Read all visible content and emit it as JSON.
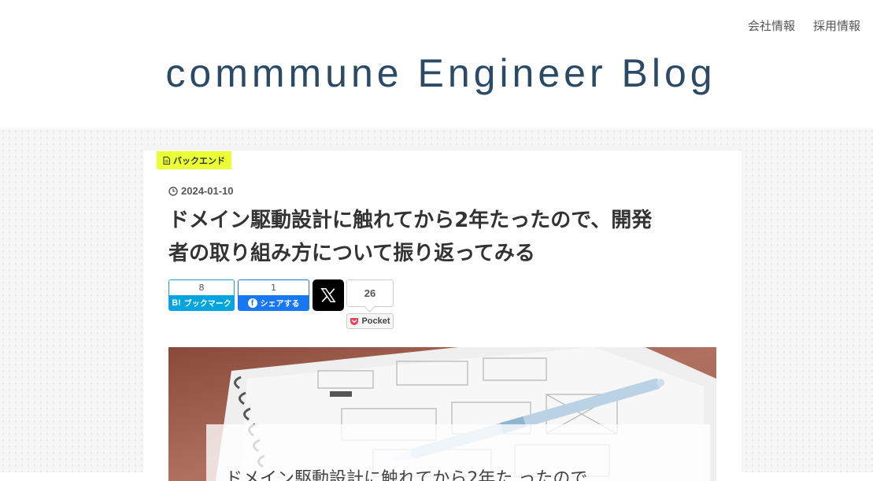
{
  "header": {
    "nav": [
      {
        "label": "会社情報"
      },
      {
        "label": "採用情報"
      }
    ],
    "site_title": "commmune Engineer Blog"
  },
  "article": {
    "category": "バックエンド",
    "category_icon": "file-icon",
    "date": "2024-01-10",
    "date_icon": "clock-icon",
    "title_line1": "ドメイン駆動設計に触れてから2年たったので、開発",
    "title_line2": "者の取り組み方について振り返ってみる",
    "share": {
      "hatena": {
        "count": "8",
        "label": "ブックマーク",
        "mark": "B!"
      },
      "facebook": {
        "count": "1",
        "label": "シェアする",
        "mark": "f"
      },
      "x": {
        "icon": "x-logo-icon"
      },
      "pocket": {
        "count": "26",
        "label": "Pocket"
      }
    },
    "eyecatch": {
      "caption": "ドメイン駆動設計に触れてから2年た ったので"
    }
  },
  "colors": {
    "title": "#2b4a66",
    "category_bg": "#ebff35",
    "hatena": "#00a4de",
    "facebook": "#1877f2",
    "pocket": "#ef4056"
  }
}
